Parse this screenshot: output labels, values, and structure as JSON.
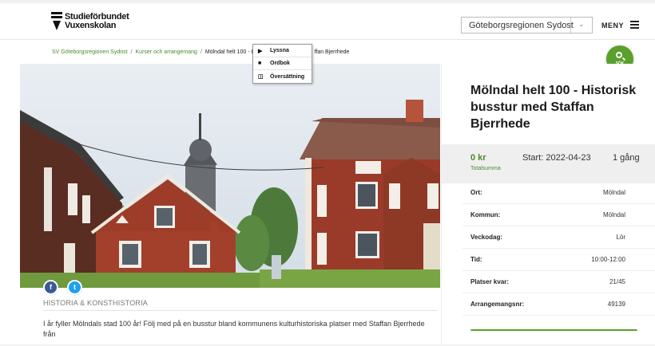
{
  "header": {
    "logo_line1": "Studieförbundet",
    "logo_line2": "Vuxenskolan",
    "region": "Göteborgsregionen Sydost",
    "menu_label": "MENY"
  },
  "breadcrumb": {
    "items": [
      "SV Göteborgsregionen Sydost",
      "Kurser och arrangemang"
    ],
    "separator": "/",
    "current_start": "Mölndal helt 100 - H",
    "current_end": "ffan Bjerrhede"
  },
  "popup": {
    "items": [
      {
        "label": "Lyssna",
        "icon": "play-icon"
      },
      {
        "label": "Ordbok",
        "icon": "book-icon"
      },
      {
        "label": "Översättning",
        "icon": "translate-icon"
      }
    ]
  },
  "search": {
    "label": "SÖK"
  },
  "social": {
    "facebook": "f",
    "twitter": "t"
  },
  "content": {
    "category": "HISTORIA & KONSTHISTORIA",
    "intro": "I år fyller Mölndals stad 100 år! Följ med på en busstur bland kommunens kulturhistoriska platser med Staffan Bjerrhede från"
  },
  "event": {
    "title": "Mölndal helt 100 - Historisk busstur med Staffan Bjerrhede",
    "price": "0 kr",
    "price_label": "Totalsumma",
    "start": "Start: 2022-04-23",
    "occasions": "1 gång",
    "details": [
      {
        "label": "Ort:",
        "value": "Mölndal"
      },
      {
        "label": "Kommun:",
        "value": "Mölndal"
      },
      {
        "label": "Veckodag:",
        "value": "Lör"
      },
      {
        "label": "Tid:",
        "value": "10:00-12:00"
      },
      {
        "label": "Platser kvar:",
        "value": "21/45"
      },
      {
        "label": "Arrangemangsnr:",
        "value": "49139"
      }
    ]
  },
  "colors": {
    "accent": "#5aa02c",
    "link": "#4a8a2e",
    "price_bg": "#efefef"
  }
}
